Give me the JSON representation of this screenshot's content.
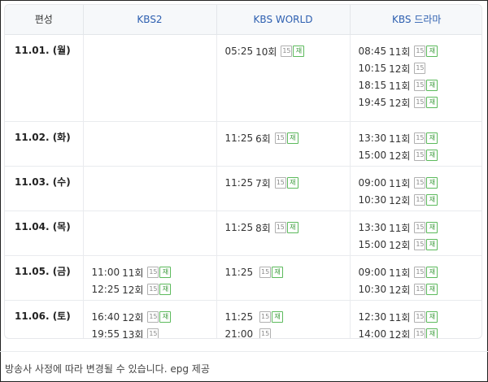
{
  "header": {
    "date_label": "편성",
    "channels": [
      "KBS2",
      "KBS WORLD",
      "KBS 드라마"
    ]
  },
  "rerun_label": "재",
  "rows": [
    {
      "date": "11.01. (월)",
      "cells": [
        [],
        [
          {
            "time": "05:25",
            "ep": "10회",
            "rating": "15",
            "rerun": true
          }
        ],
        [
          {
            "time": "08:45",
            "ep": "11회",
            "rating": "15",
            "rerun": true
          },
          {
            "time": "10:15",
            "ep": "12회",
            "rating": "15",
            "rerun": false
          },
          {
            "time": "18:15",
            "ep": "11회",
            "rating": "15",
            "rerun": true
          },
          {
            "time": "19:45",
            "ep": "12회",
            "rating": "15",
            "rerun": true
          }
        ]
      ]
    },
    {
      "date": "11.02. (화)",
      "cells": [
        [],
        [
          {
            "time": "11:25",
            "ep": "6회",
            "rating": "15",
            "rerun": true
          }
        ],
        [
          {
            "time": "13:30",
            "ep": "11회",
            "rating": "15",
            "rerun": true
          },
          {
            "time": "15:00",
            "ep": "12회",
            "rating": "15",
            "rerun": true
          }
        ]
      ]
    },
    {
      "date": "11.03. (수)",
      "cells": [
        [],
        [
          {
            "time": "11:25",
            "ep": "7회",
            "rating": "15",
            "rerun": true
          }
        ],
        [
          {
            "time": "09:00",
            "ep": "11회",
            "rating": "15",
            "rerun": true
          },
          {
            "time": "10:30",
            "ep": "12회",
            "rating": "15",
            "rerun": true
          }
        ]
      ]
    },
    {
      "date": "11.04. (목)",
      "cells": [
        [],
        [
          {
            "time": "11:25",
            "ep": "8회",
            "rating": "15",
            "rerun": true
          }
        ],
        [
          {
            "time": "13:30",
            "ep": "11회",
            "rating": "15",
            "rerun": true
          },
          {
            "time": "15:00",
            "ep": "12회",
            "rating": "15",
            "rerun": true
          }
        ]
      ]
    },
    {
      "date": "11.05. (금)",
      "cells": [
        [
          {
            "time": "11:00",
            "ep": "11회",
            "rating": "15",
            "rerun": true
          },
          {
            "time": "12:25",
            "ep": "12회",
            "rating": "15",
            "rerun": true
          }
        ],
        [
          {
            "time": "11:25",
            "ep": "",
            "rating": "15",
            "rerun": true
          }
        ],
        [
          {
            "time": "09:00",
            "ep": "11회",
            "rating": "15",
            "rerun": true
          },
          {
            "time": "10:30",
            "ep": "12회",
            "rating": "15",
            "rerun": true
          }
        ]
      ]
    },
    {
      "date": "11.06. (토)",
      "cells": [
        [
          {
            "time": "16:40",
            "ep": "12회",
            "rating": "15",
            "rerun": true
          },
          {
            "time": "19:55",
            "ep": "13회",
            "rating": "15",
            "rerun": false
          }
        ],
        [
          {
            "time": "11:25",
            "ep": "",
            "rating": "15",
            "rerun": true
          },
          {
            "time": "21:00",
            "ep": "",
            "rating": "15",
            "rerun": false
          }
        ],
        [
          {
            "time": "12:30",
            "ep": "11회",
            "rating": "15",
            "rerun": true
          },
          {
            "time": "14:00",
            "ep": "12회",
            "rating": "15",
            "rerun": true
          }
        ]
      ]
    }
  ],
  "footer": {
    "notice": "방송사 사정에 따라 변경될 수 있습니다. epg 제공"
  },
  "colors": {
    "channel_header": "#2d5fb0",
    "rerun_badge": "#5cba5c",
    "rating_badge": "#b0b0b0"
  }
}
